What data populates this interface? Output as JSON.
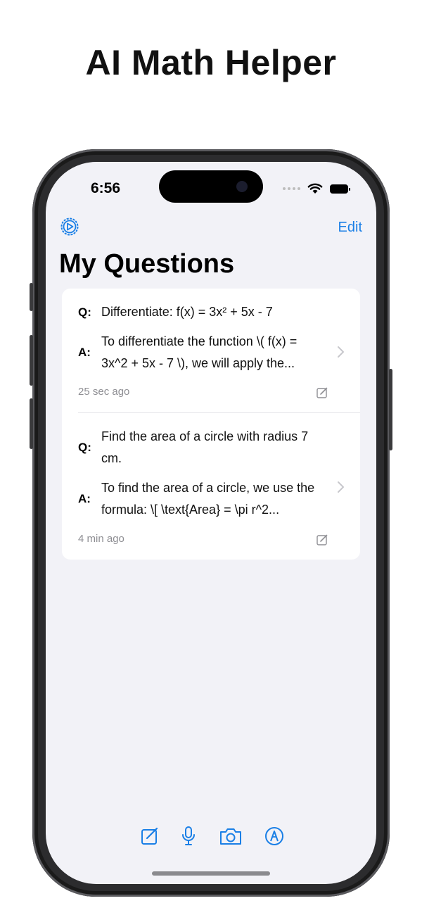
{
  "promo": {
    "title": "AI Math Helper"
  },
  "status_bar": {
    "time": "6:56"
  },
  "nav": {
    "edit_label": "Edit",
    "settings_icon": "gear-icon"
  },
  "page": {
    "title": "My Questions"
  },
  "questions": [
    {
      "q_tag": "Q:",
      "question": "Differentiate: f(x) = 3x² + 5x - 7",
      "a_tag": "A:",
      "answer": "To differentiate the function \\( f(x) = 3x^2 + 5x - 7 \\), we will apply the...",
      "time": "25 sec ago"
    },
    {
      "q_tag": "Q:",
      "question": "Find the area of a circle with radius 7 cm.",
      "a_tag": "A:",
      "answer": "To find the area of a circle, we use the formula: \\[ \\text{Area} = \\pi r^2...",
      "time": "4 min ago"
    }
  ],
  "toolbar": {
    "items": [
      "compose-icon",
      "microphone-icon",
      "camera-icon",
      "pencil-circle-icon"
    ]
  },
  "colors": {
    "accent": "#1a7fe6",
    "background": "#f2f2f7",
    "card": "#ffffff",
    "secondary_text": "#8e8e93"
  }
}
